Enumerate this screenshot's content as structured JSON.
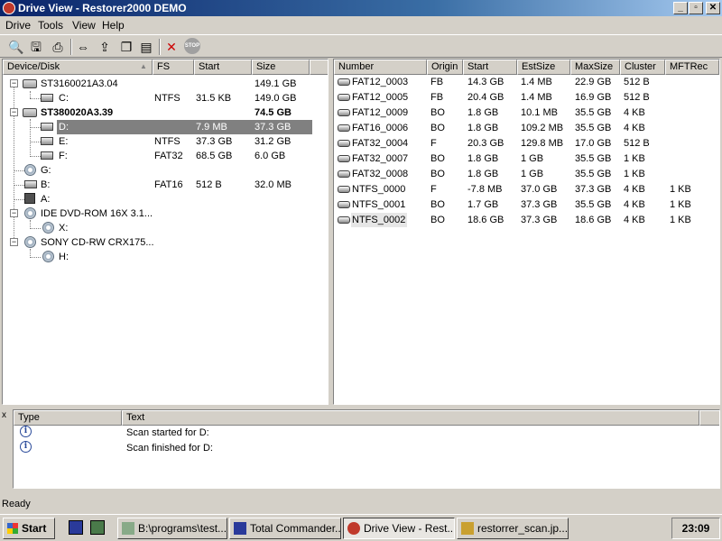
{
  "window": {
    "title": "Drive View - Restorer2000 DEMO",
    "minimize": "_",
    "maximize": "▫",
    "close": "✕"
  },
  "menu": [
    "Drive",
    "Tools",
    "View",
    "Help"
  ],
  "left_panel": {
    "columns": [
      "Device/Disk",
      "FS",
      "Start",
      "Size"
    ],
    "rows": [
      {
        "name": "ST3160021A3.04",
        "fs": "",
        "start": "",
        "size": "149.1 GB"
      },
      {
        "name": "C:",
        "fs": "NTFS",
        "start": "31.5 KB",
        "size": "149.0 GB"
      },
      {
        "name": "ST380020A3.39",
        "fs": "",
        "start": "",
        "size": "74.5 GB"
      },
      {
        "name": "D:",
        "fs": "",
        "start": "7.9 MB",
        "size": "37.3 GB"
      },
      {
        "name": "E:",
        "fs": "NTFS",
        "start": "37.3 GB",
        "size": "31.2 GB"
      },
      {
        "name": "F:",
        "fs": "FAT32",
        "start": "68.5 GB",
        "size": "6.0 GB"
      },
      {
        "name": "G:",
        "fs": "",
        "start": "",
        "size": ""
      },
      {
        "name": "B:",
        "fs": "FAT16",
        "start": "512 B",
        "size": "32.0 MB"
      },
      {
        "name": "A:",
        "fs": "",
        "start": "",
        "size": ""
      },
      {
        "name": "IDE DVD-ROM 16X 3.1...",
        "fs": "",
        "start": "",
        "size": ""
      },
      {
        "name": "X:",
        "fs": "",
        "start": "",
        "size": ""
      },
      {
        "name": "SONY CD-RW CRX175...",
        "fs": "",
        "start": "",
        "size": ""
      },
      {
        "name": "H:",
        "fs": "",
        "start": "",
        "size": ""
      }
    ]
  },
  "right_panel": {
    "columns": [
      "Number",
      "Origin",
      "Start",
      "EstSize",
      "MaxSize",
      "Cluster",
      "MFTRec"
    ],
    "rows": [
      [
        "FAT12_0003",
        "FB",
        "14.3 GB",
        "1.4 MB",
        "22.9 GB",
        "512 B",
        ""
      ],
      [
        "FAT12_0005",
        "FB",
        "20.4 GB",
        "1.4 MB",
        "16.9 GB",
        "512 B",
        ""
      ],
      [
        "FAT12_0009",
        "BO",
        "1.8 GB",
        "10.1 MB",
        "35.5 GB",
        "4 KB",
        ""
      ],
      [
        "FAT16_0006",
        "BO",
        "1.8 GB",
        "109.2 MB",
        "35.5 GB",
        "4 KB",
        ""
      ],
      [
        "FAT32_0004",
        "F",
        "20.3 GB",
        "129.8 MB",
        "17.0 GB",
        "512 B",
        ""
      ],
      [
        "FAT32_0007",
        "BO",
        "1.8 GB",
        "1 GB",
        "35.5 GB",
        "1 KB",
        ""
      ],
      [
        "FAT32_0008",
        "BO",
        "1.8 GB",
        "1 GB",
        "35.5 GB",
        "1 KB",
        ""
      ],
      [
        "NTFS_0000",
        "F",
        "-7.8 MB",
        "37.0 GB",
        "37.3 GB",
        "4 KB",
        "1 KB"
      ],
      [
        "NTFS_0001",
        "BO",
        "1.7 GB",
        "37.3 GB",
        "35.5 GB",
        "4 KB",
        "1 KB"
      ],
      [
        "NTFS_0002",
        "BO",
        "18.6 GB",
        "37.3 GB",
        "18.6 GB",
        "4 KB",
        "1 KB"
      ]
    ]
  },
  "log": {
    "close": "x",
    "columns": [
      "Type",
      "Text"
    ],
    "rows": [
      {
        "type_icon": "info-icon",
        "text": "Scan started for D:"
      },
      {
        "type_icon": "info-icon",
        "text": "Scan finished for D:"
      }
    ]
  },
  "status": "Ready",
  "taskbar": {
    "start": "Start",
    "tasks": [
      "B:\\programs\\test...",
      "Total Commander...",
      "Drive View - Rest...",
      "restorrer_scan.jp..."
    ],
    "clock": "23:09"
  },
  "colors": {
    "title_gradient_start": "#0a246a",
    "selection": "#808080",
    "face": "#d4d0c8"
  }
}
